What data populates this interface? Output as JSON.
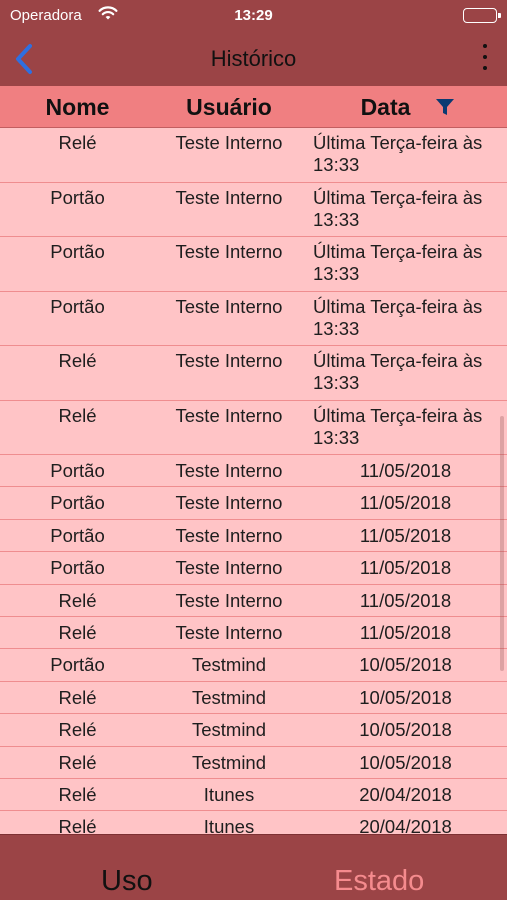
{
  "status_bar": {
    "carrier": "Operadora",
    "time": "13:29"
  },
  "nav": {
    "title": "Histórico"
  },
  "table": {
    "headers": {
      "nome": "Nome",
      "usuario": "Usuário",
      "data": "Data"
    },
    "cut_top_text": "13:33",
    "rows": [
      {
        "nome": "Relé",
        "usuario": "Teste Interno",
        "data": "Última Terça-feira às 13:33"
      },
      {
        "nome": "Portão",
        "usuario": "Teste Interno",
        "data": "Última Terça-feira às 13:33"
      },
      {
        "nome": "Portão",
        "usuario": "Teste Interno",
        "data": "Última Terça-feira às 13:33"
      },
      {
        "nome": "Portão",
        "usuario": "Teste Interno",
        "data": "Última Terça-feira às 13:33"
      },
      {
        "nome": "Relé",
        "usuario": "Teste Interno",
        "data": "Última Terça-feira às 13:33"
      },
      {
        "nome": "Relé",
        "usuario": "Teste Interno",
        "data": "Última Terça-feira às 13:33"
      },
      {
        "nome": "Portão",
        "usuario": "Teste Interno",
        "data": "11/05/2018"
      },
      {
        "nome": "Portão",
        "usuario": "Teste Interno",
        "data": "11/05/2018"
      },
      {
        "nome": "Portão",
        "usuario": "Teste Interno",
        "data": "11/05/2018"
      },
      {
        "nome": "Portão",
        "usuario": "Teste Interno",
        "data": "11/05/2018"
      },
      {
        "nome": "Relé",
        "usuario": "Teste Interno",
        "data": "11/05/2018"
      },
      {
        "nome": "Relé",
        "usuario": "Teste Interno",
        "data": "11/05/2018"
      },
      {
        "nome": "Portão",
        "usuario": "Testmind",
        "data": "10/05/2018"
      },
      {
        "nome": "Relé",
        "usuario": "Testmind",
        "data": "10/05/2018"
      },
      {
        "nome": "Relé",
        "usuario": "Testmind",
        "data": "10/05/2018"
      },
      {
        "nome": "Relé",
        "usuario": "Testmind",
        "data": "10/05/2018"
      },
      {
        "nome": "Relé",
        "usuario": "Itunes",
        "data": "20/04/2018"
      },
      {
        "nome": "Relé",
        "usuario": "Itunes",
        "data": "20/04/2018"
      }
    ]
  },
  "tabs": {
    "uso": "Uso",
    "estado": "Estado"
  },
  "colors": {
    "bar": "#9b4446",
    "header": "#f07f81",
    "rows": "#ffc4c6",
    "divider": "#ef8d8f",
    "accent_back": "#2f6fe0",
    "filter": "#0a3a72",
    "tab_inactive": "#f58b8e"
  },
  "icons": {
    "back": "chevron-left-icon",
    "more": "more-vertical-icon",
    "filter": "filter-funnel-icon",
    "wifi": "wifi-icon",
    "battery": "battery-icon"
  }
}
